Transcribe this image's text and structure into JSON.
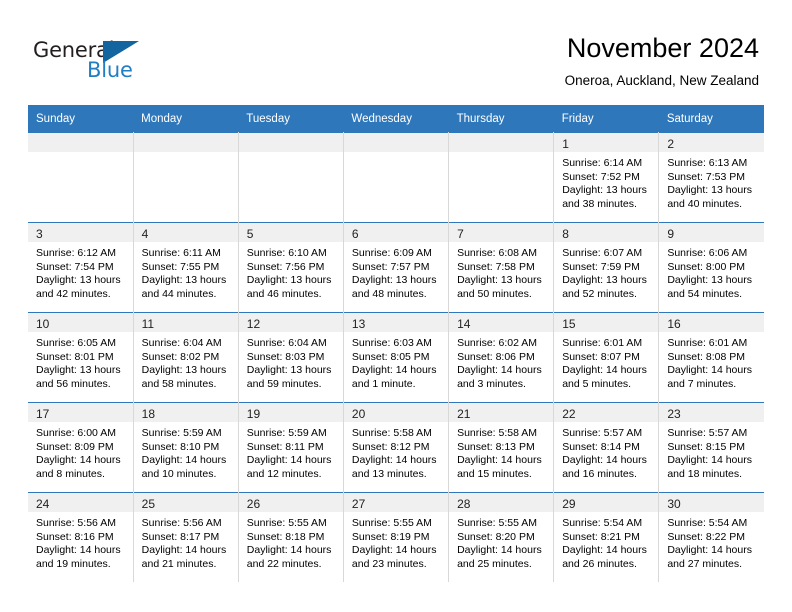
{
  "logo": {
    "word_one": "General",
    "word_two": "Blue",
    "triangle_color": "#12659e",
    "blue_text_color": "#1f7ec4",
    "icon": "triangle-logo-icon"
  },
  "header": {
    "title": "November 2024",
    "subtitle": "Oneroa, Auckland, New Zealand"
  },
  "theme": {
    "header_bg": "#2f77bb",
    "daynum_bg": "#f0f0f0",
    "grid_line": "#d8d8d8"
  },
  "weekdays": [
    "Sunday",
    "Monday",
    "Tuesday",
    "Wednesday",
    "Thursday",
    "Friday",
    "Saturday"
  ],
  "weeks": [
    [
      {
        "day": "",
        "lines": []
      },
      {
        "day": "",
        "lines": []
      },
      {
        "day": "",
        "lines": []
      },
      {
        "day": "",
        "lines": []
      },
      {
        "day": "",
        "lines": []
      },
      {
        "day": "1",
        "lines": [
          "Sunrise: 6:14 AM",
          "Sunset: 7:52 PM",
          "Daylight: 13 hours",
          "and 38 minutes."
        ]
      },
      {
        "day": "2",
        "lines": [
          "Sunrise: 6:13 AM",
          "Sunset: 7:53 PM",
          "Daylight: 13 hours",
          "and 40 minutes."
        ]
      }
    ],
    [
      {
        "day": "3",
        "lines": [
          "Sunrise: 6:12 AM",
          "Sunset: 7:54 PM",
          "Daylight: 13 hours",
          "and 42 minutes."
        ]
      },
      {
        "day": "4",
        "lines": [
          "Sunrise: 6:11 AM",
          "Sunset: 7:55 PM",
          "Daylight: 13 hours",
          "and 44 minutes."
        ]
      },
      {
        "day": "5",
        "lines": [
          "Sunrise: 6:10 AM",
          "Sunset: 7:56 PM",
          "Daylight: 13 hours",
          "and 46 minutes."
        ]
      },
      {
        "day": "6",
        "lines": [
          "Sunrise: 6:09 AM",
          "Sunset: 7:57 PM",
          "Daylight: 13 hours",
          "and 48 minutes."
        ]
      },
      {
        "day": "7",
        "lines": [
          "Sunrise: 6:08 AM",
          "Sunset: 7:58 PM",
          "Daylight: 13 hours",
          "and 50 minutes."
        ]
      },
      {
        "day": "8",
        "lines": [
          "Sunrise: 6:07 AM",
          "Sunset: 7:59 PM",
          "Daylight: 13 hours",
          "and 52 minutes."
        ]
      },
      {
        "day": "9",
        "lines": [
          "Sunrise: 6:06 AM",
          "Sunset: 8:00 PM",
          "Daylight: 13 hours",
          "and 54 minutes."
        ]
      }
    ],
    [
      {
        "day": "10",
        "lines": [
          "Sunrise: 6:05 AM",
          "Sunset: 8:01 PM",
          "Daylight: 13 hours",
          "and 56 minutes."
        ]
      },
      {
        "day": "11",
        "lines": [
          "Sunrise: 6:04 AM",
          "Sunset: 8:02 PM",
          "Daylight: 13 hours",
          "and 58 minutes."
        ]
      },
      {
        "day": "12",
        "lines": [
          "Sunrise: 6:04 AM",
          "Sunset: 8:03 PM",
          "Daylight: 13 hours",
          "and 59 minutes."
        ]
      },
      {
        "day": "13",
        "lines": [
          "Sunrise: 6:03 AM",
          "Sunset: 8:05 PM",
          "Daylight: 14 hours",
          "and 1 minute."
        ]
      },
      {
        "day": "14",
        "lines": [
          "Sunrise: 6:02 AM",
          "Sunset: 8:06 PM",
          "Daylight: 14 hours",
          "and 3 minutes."
        ]
      },
      {
        "day": "15",
        "lines": [
          "Sunrise: 6:01 AM",
          "Sunset: 8:07 PM",
          "Daylight: 14 hours",
          "and 5 minutes."
        ]
      },
      {
        "day": "16",
        "lines": [
          "Sunrise: 6:01 AM",
          "Sunset: 8:08 PM",
          "Daylight: 14 hours",
          "and 7 minutes."
        ]
      }
    ],
    [
      {
        "day": "17",
        "lines": [
          "Sunrise: 6:00 AM",
          "Sunset: 8:09 PM",
          "Daylight: 14 hours",
          "and 8 minutes."
        ]
      },
      {
        "day": "18",
        "lines": [
          "Sunrise: 5:59 AM",
          "Sunset: 8:10 PM",
          "Daylight: 14 hours",
          "and 10 minutes."
        ]
      },
      {
        "day": "19",
        "lines": [
          "Sunrise: 5:59 AM",
          "Sunset: 8:11 PM",
          "Daylight: 14 hours",
          "and 12 minutes."
        ]
      },
      {
        "day": "20",
        "lines": [
          "Sunrise: 5:58 AM",
          "Sunset: 8:12 PM",
          "Daylight: 14 hours",
          "and 13 minutes."
        ]
      },
      {
        "day": "21",
        "lines": [
          "Sunrise: 5:58 AM",
          "Sunset: 8:13 PM",
          "Daylight: 14 hours",
          "and 15 minutes."
        ]
      },
      {
        "day": "22",
        "lines": [
          "Sunrise: 5:57 AM",
          "Sunset: 8:14 PM",
          "Daylight: 14 hours",
          "and 16 minutes."
        ]
      },
      {
        "day": "23",
        "lines": [
          "Sunrise: 5:57 AM",
          "Sunset: 8:15 PM",
          "Daylight: 14 hours",
          "and 18 minutes."
        ]
      }
    ],
    [
      {
        "day": "24",
        "lines": [
          "Sunrise: 5:56 AM",
          "Sunset: 8:16 PM",
          "Daylight: 14 hours",
          "and 19 minutes."
        ]
      },
      {
        "day": "25",
        "lines": [
          "Sunrise: 5:56 AM",
          "Sunset: 8:17 PM",
          "Daylight: 14 hours",
          "and 21 minutes."
        ]
      },
      {
        "day": "26",
        "lines": [
          "Sunrise: 5:55 AM",
          "Sunset: 8:18 PM",
          "Daylight: 14 hours",
          "and 22 minutes."
        ]
      },
      {
        "day": "27",
        "lines": [
          "Sunrise: 5:55 AM",
          "Sunset: 8:19 PM",
          "Daylight: 14 hours",
          "and 23 minutes."
        ]
      },
      {
        "day": "28",
        "lines": [
          "Sunrise: 5:55 AM",
          "Sunset: 8:20 PM",
          "Daylight: 14 hours",
          "and 25 minutes."
        ]
      },
      {
        "day": "29",
        "lines": [
          "Sunrise: 5:54 AM",
          "Sunset: 8:21 PM",
          "Daylight: 14 hours",
          "and 26 minutes."
        ]
      },
      {
        "day": "30",
        "lines": [
          "Sunrise: 5:54 AM",
          "Sunset: 8:22 PM",
          "Daylight: 14 hours",
          "and 27 minutes."
        ]
      }
    ]
  ]
}
